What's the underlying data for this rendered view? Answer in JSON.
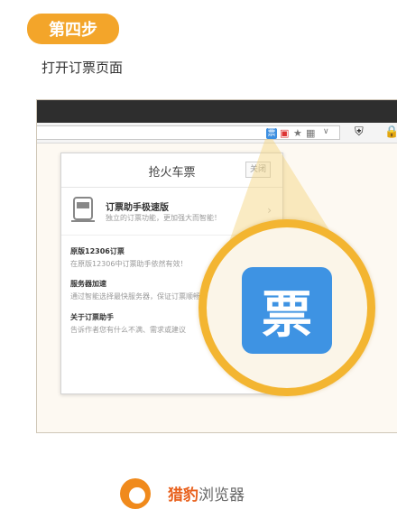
{
  "step": {
    "badge": "第四步",
    "title": "打开订票页面"
  },
  "browser": {
    "toolbar": {
      "ticket_icon_text": "票",
      "star_icon": "★",
      "dropdown": "∨",
      "shield_icon": "⛨",
      "lock_icon": "🔒"
    },
    "popup": {
      "title": "抢火车票",
      "close_label": "关闭",
      "feature": {
        "title": "订票助手极速版",
        "desc": "独立的订票功能，更加强大而智能！"
      },
      "items": [
        {
          "title": "原版12306订票",
          "desc": "在原版12306中订票助手依然有效！"
        },
        {
          "title": "服务器加速",
          "desc": "通过智能选择最快服务器，保证订票顺畅"
        },
        {
          "title": "关于订票助手",
          "desc": "告诉作者您有什么不满、需求或建议"
        }
      ]
    },
    "magnified_icon_text": "票"
  },
  "footer": {
    "brand_bold": "猎豹",
    "brand_rest": "浏览器"
  },
  "colors": {
    "accent": "#f3a52a",
    "ticket_blue": "#3e93e3"
  }
}
